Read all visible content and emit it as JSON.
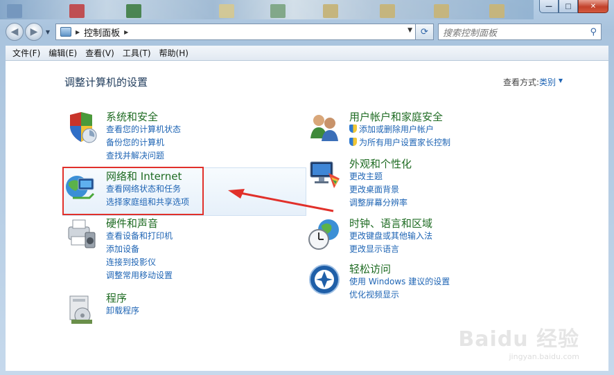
{
  "window": {
    "minimize_label": "—",
    "maximize_label": "□",
    "close_label": "✕"
  },
  "address": {
    "breadcrumb": "控制面板",
    "search_placeholder": "搜索控制面板"
  },
  "menu": [
    "文件(F)",
    "编辑(E)",
    "查看(V)",
    "工具(T)",
    "帮助(H)"
  ],
  "page": {
    "title": "调整计算机的设置",
    "view_by_label": "查看方式:",
    "view_by_value": "类别"
  },
  "categories": {
    "system": {
      "title": "系统和安全",
      "links": [
        "查看您的计算机状态",
        "备份您的计算机",
        "查找并解决问题"
      ]
    },
    "network": {
      "title": "网络和 Internet",
      "links": [
        "查看网络状态和任务",
        "选择家庭组和共享选项"
      ]
    },
    "hardware": {
      "title": "硬件和声音",
      "links": [
        "查看设备和打印机",
        "添加设备",
        "连接到投影仪",
        "调整常用移动设置"
      ]
    },
    "programs": {
      "title": "程序",
      "links": [
        "卸载程序"
      ]
    },
    "users": {
      "title": "用户帐户和家庭安全",
      "links": [
        "添加或删除用户帐户",
        "为所有用户设置家长控制"
      ]
    },
    "appearance": {
      "title": "外观和个性化",
      "links": [
        "更改主题",
        "更改桌面背景",
        "调整屏幕分辨率"
      ]
    },
    "clock": {
      "title": "时钟、语言和区域",
      "links": [
        "更改键盘或其他输入法",
        "更改显示语言"
      ]
    },
    "ease": {
      "title": "轻松访问",
      "links": [
        "使用 Windows 建议的设置",
        "优化视频显示"
      ]
    }
  },
  "watermark": {
    "line1": "Baidu 经验",
    "line2": "jingyan.baidu.com"
  },
  "colors": {
    "link": "#1e64b4",
    "category_title": "#1e6b22",
    "annotation_red": "#e1302a"
  }
}
